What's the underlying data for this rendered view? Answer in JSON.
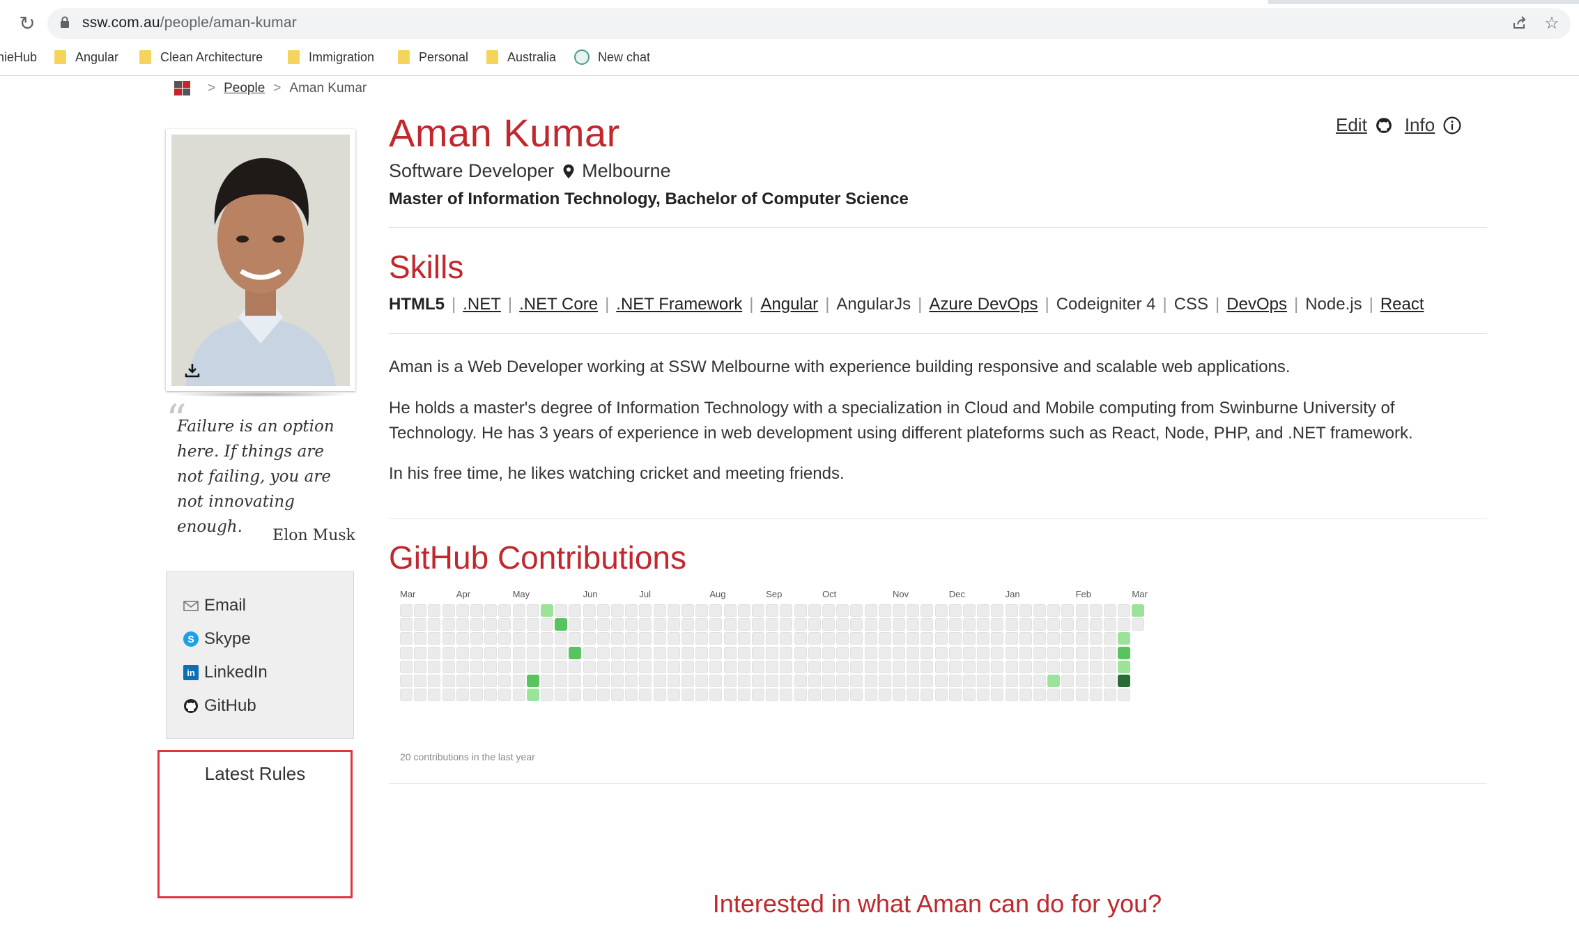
{
  "browser": {
    "url_host": "ssw.com.au",
    "url_path": "/people/aman-kumar",
    "bookmarks": [
      {
        "label": "nieHub",
        "type": "text"
      },
      {
        "label": "Angular",
        "type": "folder"
      },
      {
        "label": "Clean Architecture",
        "type": "folder"
      },
      {
        "label": "Immigration",
        "type": "folder"
      },
      {
        "label": "Personal",
        "type": "folder"
      },
      {
        "label": "Australia",
        "type": "folder"
      },
      {
        "label": "New chat",
        "type": "chat"
      }
    ]
  },
  "breadcrumb": {
    "items": [
      {
        "label": "People",
        "link": true
      },
      {
        "label": "Aman Kumar",
        "link": false
      }
    ],
    "separator": ">"
  },
  "profile": {
    "name": "Aman Kumar",
    "role": "Software Developer",
    "location": "Melbourne",
    "degree": "Master of Information Technology, Bachelor of Computer Science",
    "edit_label": "Edit",
    "info_label": "Info"
  },
  "quote": {
    "text": "Failure is an option here. If things are not failing, you are not innovating enough.",
    "author": "Elon Musk"
  },
  "contacts": [
    {
      "label": "Email",
      "icon": "envelope-icon"
    },
    {
      "label": "Skype",
      "icon": "skype-icon"
    },
    {
      "label": "LinkedIn",
      "icon": "linkedin-icon"
    },
    {
      "label": "GitHub",
      "icon": "github-icon"
    }
  ],
  "rules": {
    "title": "Latest Rules"
  },
  "skills": {
    "title": "Skills",
    "items": [
      {
        "label": "HTML5",
        "style": "bold"
      },
      {
        "label": ".NET",
        "style": "link"
      },
      {
        "label": ".NET Core",
        "style": "link"
      },
      {
        "label": ".NET Framework",
        "style": "link"
      },
      {
        "label": "Angular",
        "style": "link"
      },
      {
        "label": "AngularJs",
        "style": "plain"
      },
      {
        "label": "Azure DevOps",
        "style": "link"
      },
      {
        "label": "Codeigniter 4",
        "style": "plain"
      },
      {
        "label": "CSS",
        "style": "plain"
      },
      {
        "label": "DevOps",
        "style": "link"
      },
      {
        "label": "Node.js",
        "style": "plain"
      },
      {
        "label": "React",
        "style": "link"
      }
    ]
  },
  "bio": [
    "Aman is a Web Developer working at SSW Melbourne with experience building responsive and scalable web applications.",
    "He holds a master's degree of Information Technology with a specialization in Cloud and Mobile computing from Swinburne University of Technology. He has 3 years of experience in web development using different plateforms such as React, Node, PHP, and .NET framework.",
    "In his free time, he likes watching cricket and meeting friends."
  ],
  "github": {
    "title": "GitHub Contributions",
    "months": [
      "Mar",
      "Apr",
      "May",
      "Jun",
      "Jul",
      "Aug",
      "Sep",
      "Oct",
      "Nov",
      "Dec",
      "Jan",
      "Feb",
      "Mar"
    ],
    "month_weeks": [
      0,
      4,
      8,
      13,
      17,
      22,
      26,
      30,
      35,
      39,
      43,
      48,
      52
    ],
    "weeks": 53,
    "last_week_days": 2,
    "footer": "20 contributions in the last year",
    "colors": {
      "empty": "#ebebeb",
      "l1": "#9be39b",
      "l2": "#57c45f",
      "l3": "#3fae49",
      "l4": "#2a6b35"
    },
    "contributions": [
      {
        "week": 10,
        "day": 0,
        "level": 1
      },
      {
        "week": 11,
        "day": 1,
        "level": 2
      },
      {
        "week": 12,
        "day": 3,
        "level": 2
      },
      {
        "week": 9,
        "day": 5,
        "level": 2
      },
      {
        "week": 9,
        "day": 6,
        "level": 1
      },
      {
        "week": 46,
        "day": 5,
        "level": 1
      },
      {
        "week": 51,
        "day": 2,
        "level": 1
      },
      {
        "week": 51,
        "day": 3,
        "level": 2
      },
      {
        "week": 51,
        "day": 4,
        "level": 1
      },
      {
        "week": 51,
        "day": 5,
        "level": 4
      },
      {
        "week": 52,
        "day": 0,
        "level": 1
      }
    ]
  },
  "cta": {
    "text": "Interested in what Aman can do for you?"
  }
}
